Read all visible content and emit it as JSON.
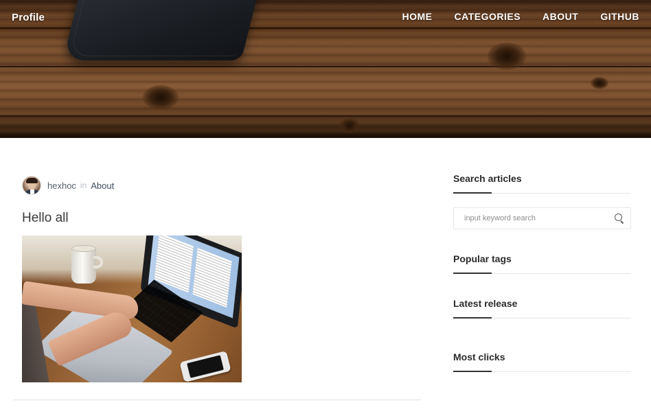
{
  "header": {
    "brand": "Profile",
    "nav": [
      {
        "label": "HOME"
      },
      {
        "label": "CATEGORIES"
      },
      {
        "label": "ABOUT"
      },
      {
        "label": "GITHUB"
      }
    ]
  },
  "post": {
    "author": "hexhoc",
    "in_word": "in",
    "category": "About",
    "title": "Hello all"
  },
  "sidebar": {
    "search": {
      "title": "Search articles",
      "placeholder": "input keyword search"
    },
    "popular_tags": {
      "title": "Popular tags"
    },
    "latest_release": {
      "title": "Latest release"
    },
    "most_clicks": {
      "title": "Most clicks"
    }
  }
}
